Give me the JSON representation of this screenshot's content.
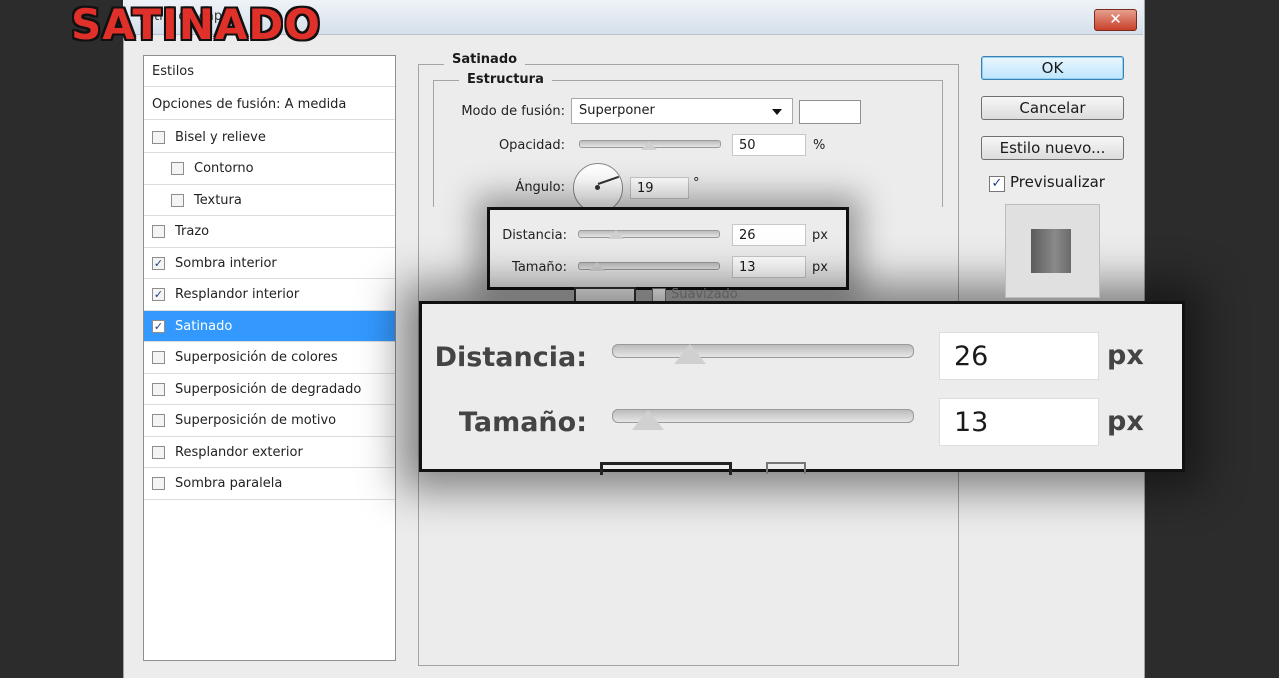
{
  "overlay_title": "SATINADO",
  "window": {
    "title": "Estilo de capa",
    "close_label": "✕"
  },
  "styles_list": {
    "header": "Estilos",
    "blend_options": "Opciones de fusión: A medida",
    "items": [
      {
        "label": "Bisel y relieve",
        "checked": false,
        "indent": false
      },
      {
        "label": "Contorno",
        "checked": false,
        "indent": true
      },
      {
        "label": "Textura",
        "checked": false,
        "indent": true
      },
      {
        "label": "Trazo",
        "checked": false,
        "indent": false
      },
      {
        "label": "Sombra interior",
        "checked": true,
        "indent": false
      },
      {
        "label": "Resplandor interior",
        "checked": true,
        "indent": false
      },
      {
        "label": "Satinado",
        "checked": true,
        "indent": false,
        "selected": true
      },
      {
        "label": "Superposición de colores",
        "checked": false,
        "indent": false
      },
      {
        "label": "Superposición de degradado",
        "checked": false,
        "indent": false
      },
      {
        "label": "Superposición de motivo",
        "checked": false,
        "indent": false
      },
      {
        "label": "Resplandor exterior",
        "checked": false,
        "indent": false
      },
      {
        "label": "Sombra paralela",
        "checked": false,
        "indent": false
      }
    ]
  },
  "panel": {
    "group_title": "Satinado",
    "structure_title": "Estructura",
    "blend_mode_label": "Modo de fusión:",
    "blend_mode_value": "Superponer",
    "opacity_label": "Opacidad:",
    "opacity_value": "50",
    "opacity_unit": "%",
    "opacity_fraction": 0.5,
    "angle_label": "Ángulo:",
    "angle_value": "19",
    "angle_unit": "°",
    "distance_label": "Distancia:",
    "distance_value": "26",
    "distance_unit": "px",
    "size_label": "Tamaño:",
    "size_value": "13",
    "size_unit": "px",
    "invert_label": "Suavizado"
  },
  "buttons": {
    "ok": "OK",
    "cancel": "Cancelar",
    "new_style": "Estilo nuevo...",
    "preview_label": "Previsualizar",
    "preview_checked": true
  },
  "colors": {
    "selected_row": "#3399ff",
    "title_red": "#e0302a"
  }
}
